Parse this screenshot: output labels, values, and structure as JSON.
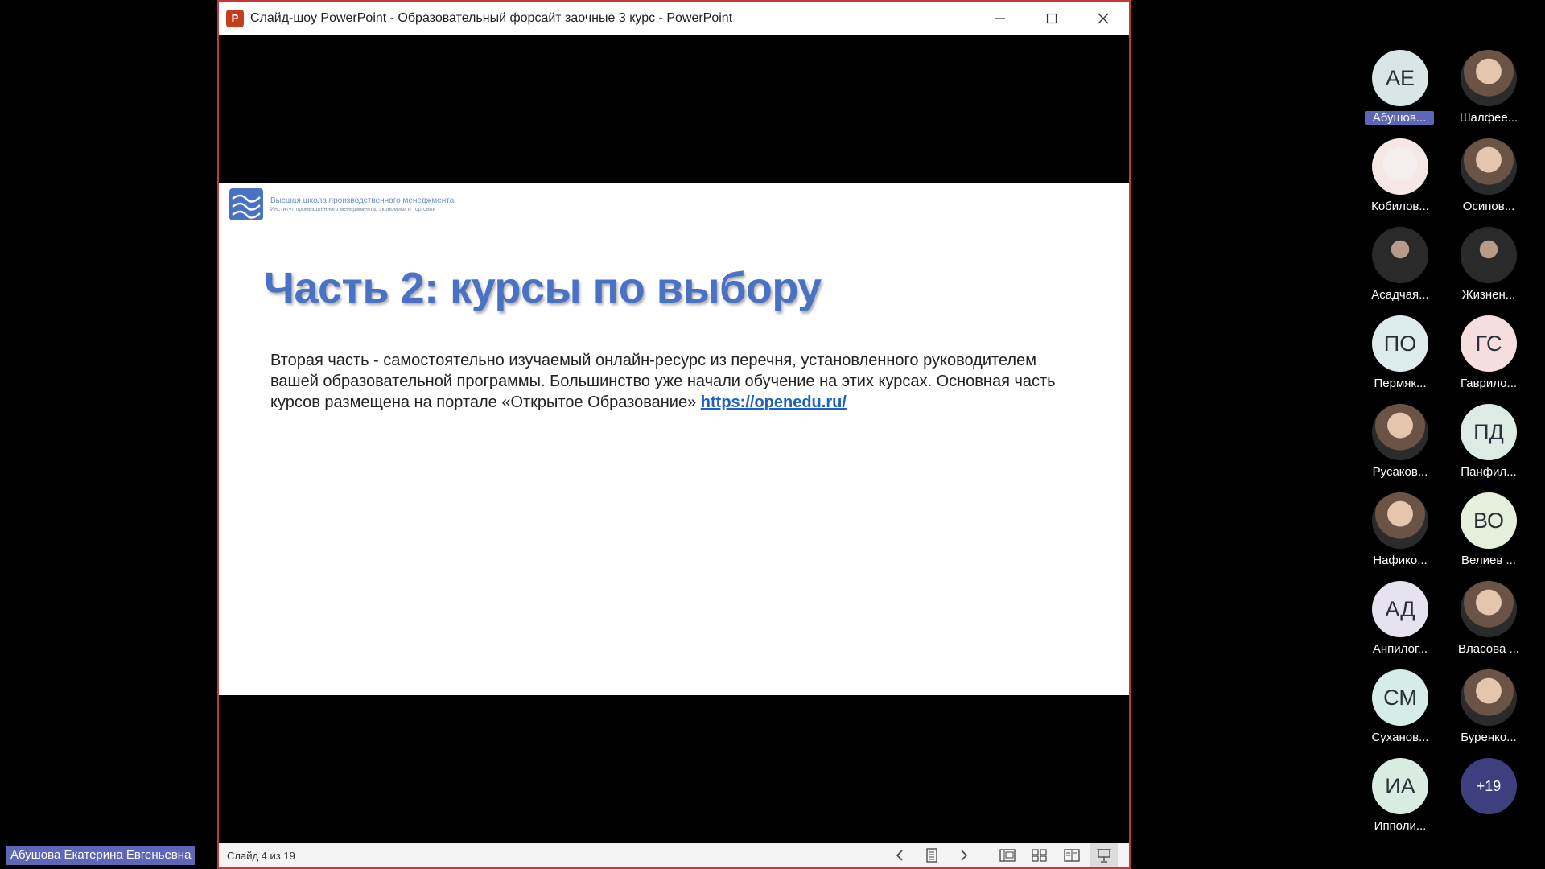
{
  "window": {
    "title": "Слайд-шоу PowerPoint  -  Образовательный форсайт заочные 3 курс - PowerPoint",
    "app_icon_letter": "P"
  },
  "slide": {
    "logo_line1": "Высшая школа производственного менеджмента",
    "logo_line2": "Институт промышленного менеджмента, экономики и торговли",
    "title": "Часть 2: курсы по выбору",
    "body_text": "Вторая часть - самостоятельно изучаемый онлайн-ресурс из перечня, установленного руководителем вашей образовательной программы. Большинство уже начали обучение на этих курсах. Основная часть курсов размещена на портале «Открытое Образование» ",
    "link": "https://openedu.ru/"
  },
  "statusbar": {
    "counter": "Слайд 4 из 19"
  },
  "presenter": {
    "name": "Абушова Екатерина Евгеньевна"
  },
  "participants": [
    {
      "initials": "АЕ",
      "name": "Абушов...",
      "bg": "#d9e6e8",
      "kind": "initials",
      "highlight": true
    },
    {
      "initials": "",
      "name": "Шалфее...",
      "bg": "#d8d8d8",
      "kind": "photo"
    },
    {
      "initials": "",
      "name": "Кобилов...",
      "bg": "#f4e8e8",
      "kind": "sketch"
    },
    {
      "initials": "",
      "name": "Осипов...",
      "bg": "#d8d8d8",
      "kind": "photo"
    },
    {
      "initials": "",
      "name": "Асадчая...",
      "bg": "#2a2a2a",
      "kind": "dark"
    },
    {
      "initials": "",
      "name": "Жизнен...",
      "bg": "#2a2a2a",
      "kind": "dark"
    },
    {
      "initials": "ПО",
      "name": "Пермяк...",
      "bg": "#dcecec",
      "kind": "initials"
    },
    {
      "initials": "ГС",
      "name": "Гаврило...",
      "bg": "#f6dede",
      "kind": "initials"
    },
    {
      "initials": "",
      "name": "Русаков...",
      "bg": "#d8d8d8",
      "kind": "photo"
    },
    {
      "initials": "ПД",
      "name": "Панфил...",
      "bg": "#dcece4",
      "kind": "initials"
    },
    {
      "initials": "",
      "name": "Нафико...",
      "bg": "#d8d8d8",
      "kind": "photo"
    },
    {
      "initials": "ВО",
      "name": "Велиев ...",
      "bg": "#e6eedc",
      "kind": "initials"
    },
    {
      "initials": "АД",
      "name": "Анпилог...",
      "bg": "#e6e2ee",
      "kind": "initials"
    },
    {
      "initials": "",
      "name": "Власова ...",
      "bg": "#d8d8d8",
      "kind": "photo"
    },
    {
      "initials": "СМ",
      "name": "Суханов...",
      "bg": "#d6ece6",
      "kind": "initials"
    },
    {
      "initials": "",
      "name": "Буренко...",
      "bg": "#d8d8d8",
      "kind": "photo"
    },
    {
      "initials": "ИА",
      "name": "Ипполи...",
      "bg": "#d8ece2",
      "kind": "initials"
    },
    {
      "initials": "+19",
      "name": "",
      "bg": "#3d3f7e",
      "kind": "plus"
    }
  ],
  "colors": {
    "accent": "#5e67b5",
    "window_border": "#c23b3b",
    "slide_title": "#4a72c4",
    "link": "#1f5fc2"
  }
}
